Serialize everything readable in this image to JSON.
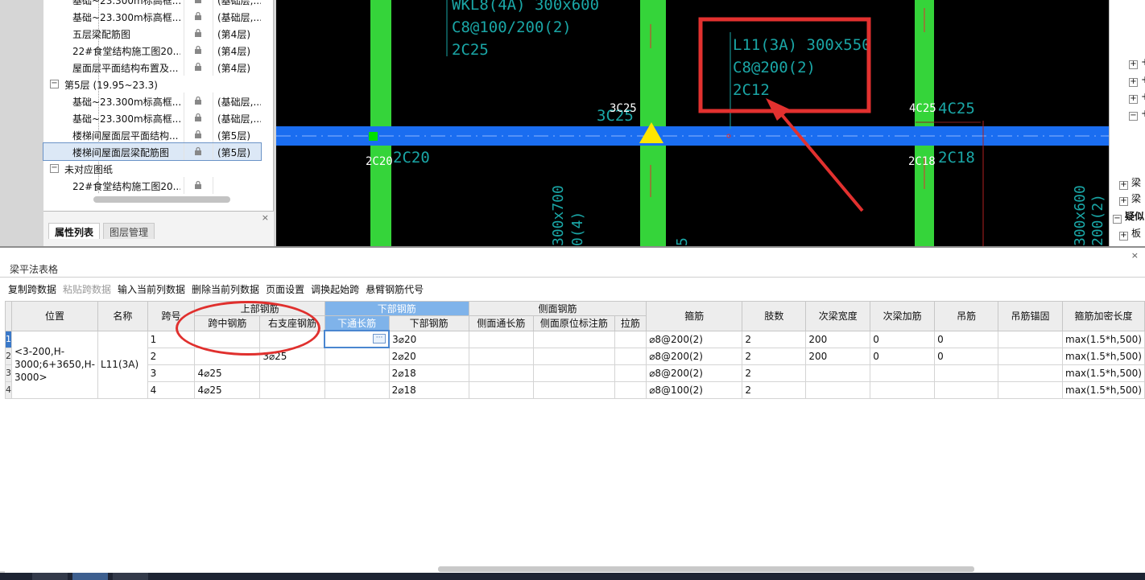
{
  "tree": {
    "rows": [
      {
        "kind": "item",
        "name": "基础~23.300m标高框...",
        "floor": "(基础层,..."
      },
      {
        "kind": "item",
        "name": "基础~23.300m标高框...",
        "floor": "(基础层,..."
      },
      {
        "kind": "item",
        "name": "五层梁配筋图",
        "floor": "(第4层)"
      },
      {
        "kind": "item",
        "name": "22#食堂结构施工图20...",
        "floor": "(第4层)"
      },
      {
        "kind": "item",
        "name": "屋面层平面结构布置及...",
        "floor": "(第4层)"
      },
      {
        "kind": "group",
        "label": "第5层 (19.95~23.3)",
        "toggle": "−"
      },
      {
        "kind": "item",
        "name": "基础~23.300m标高框...",
        "floor": "(基础层,..."
      },
      {
        "kind": "item",
        "name": "基础~23.300m标高框...",
        "floor": "(基础层,..."
      },
      {
        "kind": "item",
        "name": "楼梯间屋面层平面结构...",
        "floor": "(第5层)"
      },
      {
        "kind": "item",
        "name": "楼梯间屋面层梁配筋图",
        "floor": "(第5层)",
        "selected": true
      },
      {
        "kind": "group",
        "label": "未对应图纸",
        "toggle": "−"
      },
      {
        "kind": "item",
        "name": "22#食堂结构施工图20...",
        "floor": ""
      }
    ],
    "icon": "lock-icon"
  },
  "prop_panel": {
    "tabs": [
      "属性列表",
      "图层管理"
    ],
    "close": "×"
  },
  "cad": {
    "texts": {
      "wkl": "WKL8(4A) 300x600",
      "wkl_stirrup": "C8@100/200(2)",
      "wkl_top": "2C25",
      "beam_name": "L11(3A) 300x550",
      "beam_stirrup": "C8@200(2)",
      "beam_top": "2C12",
      "left_support_white": "3C25",
      "left_support_cyan": "3C25",
      "right_support_white": "4C25",
      "right_support_cyan": "4C25",
      "bottom_left_white": "2C20",
      "bottom_left_cyan": "2C20",
      "bottom_right_white": "2C18",
      "bottom_right_cyan": "2C18",
      "vert_left": "300x700",
      "vert_left2": "0(4)",
      "vert_mid": "5",
      "vert_right": "300x600",
      "vert_right2": "200(2)"
    },
    "colors": {
      "beam": "#1a6df0",
      "column": "#35d43a",
      "annotation_box": "#e2312f",
      "text_cyan": "#1aa6a6"
    }
  },
  "right_strip": {
    "items": [
      {
        "toggle": "+",
        "label": "+"
      },
      {
        "toggle": "+",
        "label": "+"
      },
      {
        "toggle": "+",
        "label": "+"
      },
      {
        "toggle": "−",
        "label": "+"
      },
      {
        "toggle": "+",
        "label": "梁"
      },
      {
        "toggle": "+",
        "label": "梁"
      },
      {
        "toggle": "−",
        "label": "疑似"
      },
      {
        "toggle": "+",
        "label": "板"
      }
    ]
  },
  "grid_window": {
    "title": "梁平法表格",
    "close": "×",
    "toolbar": [
      {
        "label": "复制跨数据",
        "enabled": true
      },
      {
        "label": "粘贴跨数据",
        "enabled": false
      },
      {
        "label": "输入当前列数据",
        "enabled": true
      },
      {
        "label": "删除当前列数据",
        "enabled": true
      },
      {
        "label": "页面设置",
        "enabled": true
      },
      {
        "label": "调换起始跨",
        "enabled": true
      },
      {
        "label": "悬臂钢筋代号",
        "enabled": true
      }
    ],
    "headers": {
      "position": "位置",
      "name": "名称",
      "span": "跨号",
      "top_group": "上部钢筋",
      "mid_top": "跨中钢筋",
      "right_support": "右支座钢筋",
      "bottom_group": "下部钢筋",
      "bottom_through": "下通长筋",
      "bottom_bar": "下部钢筋",
      "side_group": "侧面钢筋",
      "side_through": "侧面通长筋",
      "side_original": "侧面原位标注筋",
      "tie": "拉筋",
      "stirrup": "箍筋",
      "legs": "肢数",
      "sec_width": "次梁宽度",
      "sec_add": "次梁加筋",
      "hanger": "吊筋",
      "hanger_anchor": "吊筋锚固",
      "stirrup_dense": "箍筋加密长度"
    },
    "position_value": "<3-200,H-3000;6+3650,H-3000>",
    "name_value": "L11(3A)",
    "rows": [
      {
        "num": "1",
        "span": "1",
        "mid_top": "",
        "right_support": "",
        "bottom_through": "",
        "bottom_bar": "3⌀20",
        "stirrup": "⌀8@200(2)",
        "legs": "2",
        "sec_width": "200",
        "sec_add": "0",
        "hanger": "0",
        "dense": "max(1.5*h,500)"
      },
      {
        "num": "2",
        "span": "2",
        "mid_top": "",
        "right_support": "3⌀25",
        "bottom_through": "",
        "bottom_bar": "2⌀20",
        "stirrup": "⌀8@200(2)",
        "legs": "2",
        "sec_width": "200",
        "sec_add": "0",
        "hanger": "0",
        "dense": "max(1.5*h,500)"
      },
      {
        "num": "3",
        "span": "3",
        "mid_top": "4⌀25",
        "right_support": "",
        "bottom_through": "",
        "bottom_bar": "2⌀18",
        "stirrup": "⌀8@200(2)",
        "legs": "2",
        "sec_width": "",
        "sec_add": "",
        "hanger": "",
        "dense": "max(1.5*h,500)"
      },
      {
        "num": "4",
        "span": "4",
        "mid_top": "4⌀25",
        "right_support": "",
        "bottom_through": "",
        "bottom_bar": "2⌀18",
        "stirrup": "⌀8@100(2)",
        "legs": "2",
        "sec_width": "",
        "sec_add": "",
        "hanger": "",
        "dense": "max(1.5*h,500)"
      }
    ],
    "ellipsis": "···"
  }
}
